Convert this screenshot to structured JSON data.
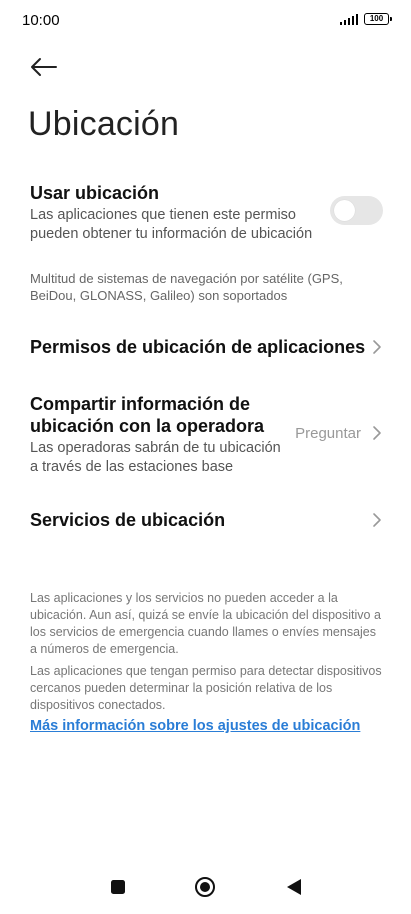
{
  "status": {
    "time": "10:00",
    "battery": "100"
  },
  "page": {
    "title": "Ubicación"
  },
  "use_location": {
    "title": "Usar ubicación",
    "subtitle": "Las aplicaciones que tienen este permiso pueden obtener tu información de ubicación",
    "enabled": false
  },
  "gnss_note": "Multitud de sistemas de navegación por satélite (GPS, BeiDou, GLONASS, Galileo) son soportados",
  "app_permissions": {
    "title": "Permisos de ubicación de aplicaciones"
  },
  "carrier_sharing": {
    "title": "Compartir información de ubicación con la operadora",
    "subtitle": "Las operadoras sabrán de tu ubicación a través de las estaciones base",
    "value": "Preguntar"
  },
  "location_services": {
    "title": "Servicios de ubicación"
  },
  "footer": {
    "para1": "Las aplicaciones y los servicios no pueden acceder a la ubicación. Aun así, quizá se envíe la ubicación del dispositivo a los servicios de emergencia cuando llames o envíes mensajes a números de emergencia.",
    "para2": "Las aplicaciones que tengan permiso para detectar dispositivos cercanos pueden determinar la posición relativa de los dispositivos conectados.",
    "link": "Más información sobre los ajustes de ubicación"
  },
  "colors": {
    "link": "#2a7dd6",
    "toggle_off": "#e6e6e6"
  },
  "icons": [
    "back-arrow-icon",
    "chevron-right-icon",
    "recents-square-icon",
    "home-circle-icon",
    "back-triangle-icon"
  ]
}
